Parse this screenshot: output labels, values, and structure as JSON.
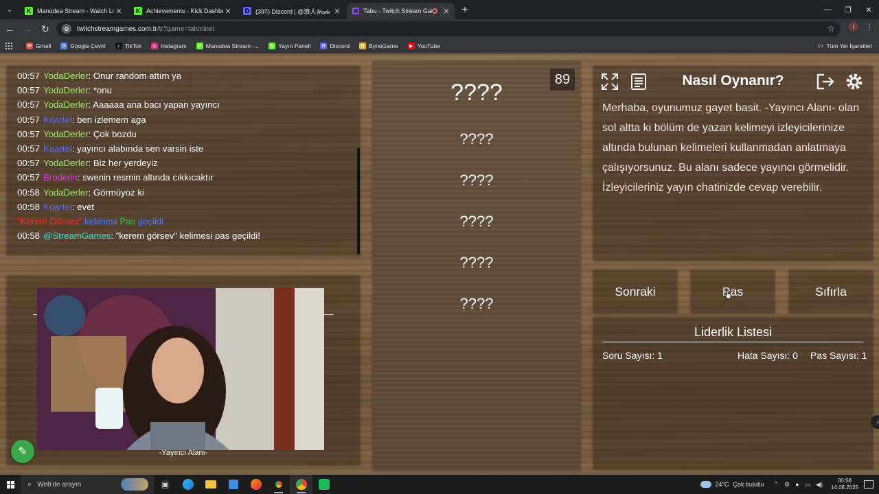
{
  "browser": {
    "tabs": [
      {
        "title": "Manodea Stream - Watch Live",
        "icon": "kick-icon",
        "color": "#53fc18",
        "glyph": "K"
      },
      {
        "title": "Achievements - Kick Dashboard",
        "icon": "kick-icon",
        "color": "#53fc18",
        "glyph": "K"
      },
      {
        "title": "(397) Discord | @浪人𝒴𝑜𝒹𝒶",
        "icon": "discord-icon",
        "color": "#5865f2",
        "glyph": "D"
      },
      {
        "title": "Tabu - Twitch Stream Game",
        "icon": "twitch-icon",
        "color": "#9146ff",
        "glyph": ""
      }
    ],
    "url_domain": "twitchstreamgames.com.tr",
    "url_path": "/tr?game=tahminet",
    "profile_initial": "I",
    "bookmarks": [
      {
        "label": "Gmail",
        "color": "#ea4335",
        "glyph": "M"
      },
      {
        "label": "Google Çeviri",
        "color": "#4285f4",
        "glyph": "G"
      },
      {
        "label": "TikTok",
        "color": "#111111",
        "glyph": "♪"
      },
      {
        "label": "Instagram",
        "color": "#d62976",
        "glyph": "◎"
      },
      {
        "label": "Manodea Stream -...",
        "color": "#53fc18",
        "glyph": "K"
      },
      {
        "label": "Yayın Paneli",
        "color": "#53fc18",
        "glyph": "K"
      },
      {
        "label": "Discord",
        "color": "#5865f2",
        "glyph": "D"
      },
      {
        "label": "BynoGame",
        "color": "#f3b21a",
        "glyph": "B"
      },
      {
        "label": "YouTube",
        "color": "#ff0000",
        "glyph": "▶"
      }
    ],
    "all_bookmarks": "Tüm Yer İşaretleri"
  },
  "chat": {
    "lines": [
      {
        "time": "00:57",
        "user": "YodaDerler",
        "cls": "u-yoda",
        "text": ": Onur random attım ya"
      },
      {
        "time": "00:57",
        "user": "YodaDerler",
        "cls": "u-yoda",
        "text": ": *onu"
      },
      {
        "time": "00:57",
        "user": "YodaDerler",
        "cls": "u-yoda",
        "text": ": Aaaaaa ana bacı yapan yayıncı"
      },
      {
        "time": "00:57",
        "user": "Kqartel",
        "cls": "u-kq",
        "text": ": ben izlemem aga"
      },
      {
        "time": "00:57",
        "user": "YodaDerler",
        "cls": "u-yoda",
        "text": ": Çok bozdu"
      },
      {
        "time": "00:57",
        "user": "Kqartel",
        "cls": "u-kq",
        "text": ": yayıncı alabında sen varsin iste"
      },
      {
        "time": "00:57",
        "user": "YodaDerler",
        "cls": "u-yoda",
        "text": ": Biz her yerdeyiz"
      },
      {
        "time": "00:57",
        "user": "Broderin",
        "cls": "u-bro",
        "text": ": swenin resmin altında cıkkıcaktır"
      },
      {
        "time": "00:58",
        "user": "YodaDerler",
        "cls": "u-yoda",
        "text": ": Görmüyoz ki"
      },
      {
        "time": "00:58",
        "user": "Kqartel",
        "cls": "u-kq",
        "text": ": evet"
      }
    ],
    "system": {
      "word": "\"Kerem Görsev\"",
      "mid": " kelimesi ",
      "pas": "Pas",
      "end": " geçildi"
    },
    "final": {
      "time": "00:58",
      "user": "@StreamGames",
      "text": ": \"kerem görsev\" kelimesi pas geçildi!"
    }
  },
  "camera": {
    "label": "-Yayıncı Alanı-"
  },
  "words": {
    "counter": "89",
    "main": "????",
    "list": [
      "????",
      "????",
      "????",
      "????",
      "????"
    ]
  },
  "info": {
    "title": "Nasıl Oynanır?",
    "text": "Merhaba, oyunumuz gayet basit. -Yayıncı Alanı- olan sol altta ki bölüm de yazan kelimeyi izleyicilerinize altında bulunan kelimeleri kullanmadan anlatmaya çalışıyorsunuz. Bu alanı sadece yayıncı görmelidir. İzleyicileriniz yayın chatinizde cevap verebilir."
  },
  "buttons": {
    "next": "Sonraki",
    "pass": "Pas",
    "reset": "Sıfırla"
  },
  "leaderboard": {
    "title": "Liderlik Listesi",
    "questions": "Soru Sayısı: 1",
    "errors": "Hata Sayısı: 0",
    "passes": "Pas Sayısı: 1"
  },
  "taskbar": {
    "search_placeholder": "Web'de arayın",
    "temperature": "24°C",
    "weather": "Çok bulutlu",
    "time": "00:58",
    "date": "14.08.2025"
  }
}
